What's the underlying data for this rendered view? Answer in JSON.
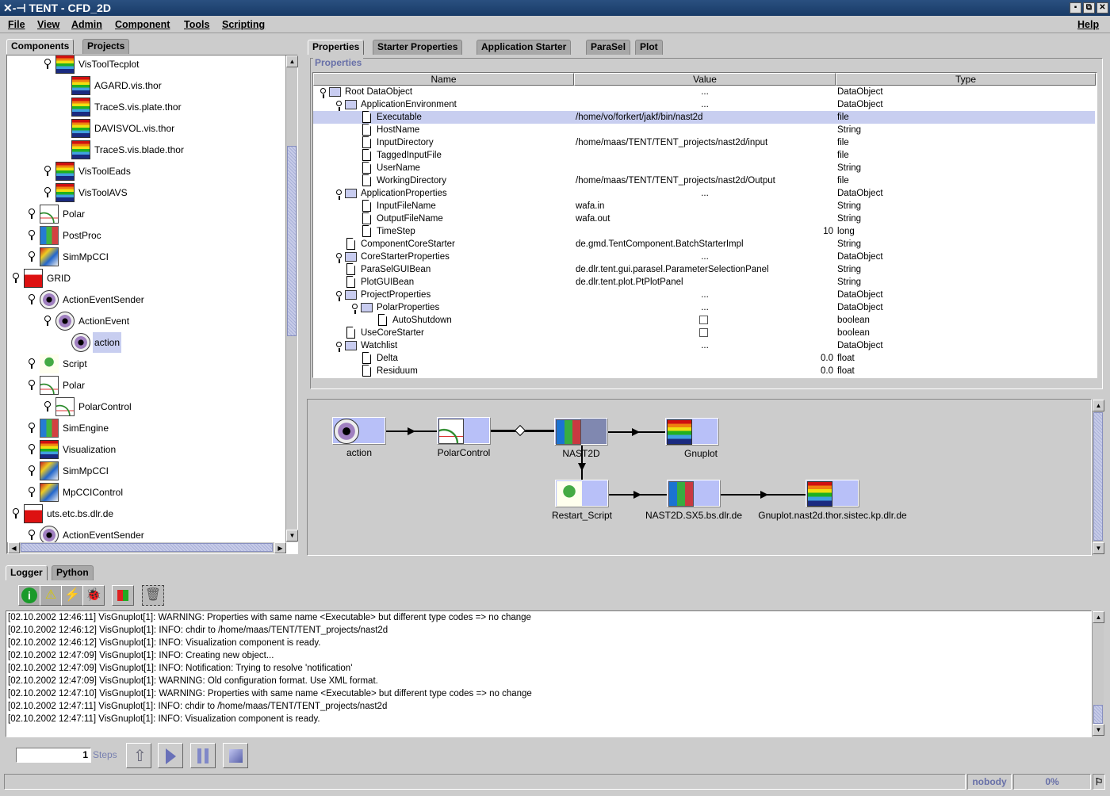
{
  "window": {
    "title": "TENT - CFD_2D"
  },
  "menu": [
    "File",
    "View",
    "Admin",
    "Component",
    "Tools",
    "Scripting"
  ],
  "help": "Help",
  "left_tabs": [
    "Components",
    "Projects"
  ],
  "tree": [
    {
      "label": "VisToolTecplot",
      "level": 3,
      "toggle": true,
      "icon": "rainbow"
    },
    {
      "label": "AGARD.vis.thor",
      "level": 4,
      "toggle": false,
      "icon": "rainbow"
    },
    {
      "label": "TraceS.vis.plate.thor",
      "level": 4,
      "toggle": false,
      "icon": "rainbow"
    },
    {
      "label": "DAVISVOL.vis.thor",
      "level": 4,
      "toggle": false,
      "icon": "rainbow"
    },
    {
      "label": "TraceS.vis.blade.thor",
      "level": 4,
      "toggle": false,
      "icon": "rainbow"
    },
    {
      "label": "VisToolEads",
      "level": 3,
      "toggle": true,
      "icon": "rainbow"
    },
    {
      "label": "VisToolAVS",
      "level": 3,
      "toggle": true,
      "icon": "rainbow"
    },
    {
      "label": "Polar",
      "level": 2,
      "toggle": true,
      "icon": "polar"
    },
    {
      "label": "PostProc",
      "level": 2,
      "toggle": true,
      "icon": "grid"
    },
    {
      "label": "SimMpCCI",
      "level": 2,
      "toggle": true,
      "icon": "simm"
    },
    {
      "label": "GRID",
      "level": 1,
      "toggle": true,
      "icon": "factory"
    },
    {
      "label": "ActionEventSender",
      "level": 2,
      "toggle": true,
      "icon": "compass"
    },
    {
      "label": "ActionEvent",
      "level": 3,
      "toggle": true,
      "icon": "compass"
    },
    {
      "label": "action",
      "level": 4,
      "toggle": false,
      "icon": "compass",
      "selected": true
    },
    {
      "label": "Script",
      "level": 2,
      "toggle": true,
      "icon": "snake"
    },
    {
      "label": "Polar",
      "level": 2,
      "toggle": true,
      "icon": "polar"
    },
    {
      "label": "PolarControl",
      "level": 3,
      "toggle": true,
      "icon": "polar"
    },
    {
      "label": "SimEngine",
      "level": 2,
      "toggle": true,
      "icon": "grid"
    },
    {
      "label": "Visualization",
      "level": 2,
      "toggle": true,
      "icon": "rainbow"
    },
    {
      "label": "SimMpCCI",
      "level": 2,
      "toggle": true,
      "icon": "simm"
    },
    {
      "label": "MpCCIControl",
      "level": 2,
      "toggle": true,
      "icon": "simm"
    },
    {
      "label": "uts.etc.bs.dlr.de",
      "level": 1,
      "toggle": true,
      "icon": "factory"
    },
    {
      "label": "ActionEventSender",
      "level": 2,
      "toggle": true,
      "icon": "compass"
    }
  ],
  "right_tabs": [
    "Properties",
    "Starter Properties",
    "Application Starter",
    "ParaSel",
    "Plot"
  ],
  "properties": {
    "group_label": "Properties",
    "columns": [
      "Name",
      "Value",
      "Type"
    ],
    "rows": [
      {
        "name": "Root DataObject",
        "value": "...",
        "type": "DataObject",
        "level": 0,
        "folder": true,
        "align": "center"
      },
      {
        "name": "ApplicationEnvironment",
        "value": "...",
        "type": "DataObject",
        "level": 1,
        "folder": true,
        "align": "center"
      },
      {
        "name": "Executable",
        "value": "/home/vo/forkert/jakf/bin/nast2d",
        "type": "file",
        "level": 2,
        "selected": true
      },
      {
        "name": "HostName",
        "value": "",
        "type": "String",
        "level": 2
      },
      {
        "name": "InputDirectory",
        "value": "/home/maas/TENT/TENT_projects/nast2d/input",
        "type": "file",
        "level": 2
      },
      {
        "name": "TaggedInputFile",
        "value": "",
        "type": "file",
        "level": 2
      },
      {
        "name": "UserName",
        "value": "",
        "type": "String",
        "level": 2
      },
      {
        "name": "WorkingDirectory",
        "value": "/home/maas/TENT/TENT_projects/nast2d/Output",
        "type": "file",
        "level": 2
      },
      {
        "name": "ApplicationProperties",
        "value": "...",
        "type": "DataObject",
        "level": 1,
        "folder": true,
        "align": "center"
      },
      {
        "name": "InputFileName",
        "value": "wafa.in",
        "type": "String",
        "level": 2
      },
      {
        "name": "OutputFileName",
        "value": "wafa.out",
        "type": "String",
        "level": 2
      },
      {
        "name": "TimeStep",
        "value": "10",
        "type": "long",
        "level": 2,
        "align": "right"
      },
      {
        "name": "ComponentCoreStarter",
        "value": "de.gmd.TentComponent.BatchStarterImpl",
        "type": "String",
        "level": 1
      },
      {
        "name": "CoreStarterProperties",
        "value": "...",
        "type": "DataObject",
        "level": 1,
        "folder": true,
        "align": "center"
      },
      {
        "name": "ParaSelGUIBean",
        "value": "de.dlr.tent.gui.parasel.ParameterSelectionPanel",
        "type": "String",
        "level": 1
      },
      {
        "name": "PlotGUIBean",
        "value": "de.dlr.tent.plot.PtPlotPanel",
        "type": "String",
        "level": 1
      },
      {
        "name": "ProjectProperties",
        "value": "...",
        "type": "DataObject",
        "level": 1,
        "folder": true,
        "align": "center"
      },
      {
        "name": "PolarProperties",
        "value": "...",
        "type": "DataObject",
        "level": 2,
        "folder": true,
        "align": "center"
      },
      {
        "name": "AutoShutdown",
        "value": "",
        "type": "boolean",
        "level": 3,
        "checkbox": true,
        "checked": false
      },
      {
        "name": "UseCoreStarter",
        "value": "",
        "type": "boolean",
        "level": 1,
        "checkbox": true,
        "checked": false
      },
      {
        "name": "Watchlist",
        "value": "...",
        "type": "DataObject",
        "level": 1,
        "folder": true,
        "align": "center"
      },
      {
        "name": "Delta",
        "value": "0.0",
        "type": "float",
        "level": 2,
        "align": "right"
      },
      {
        "name": "Residuum",
        "value": "0.0",
        "type": "float",
        "level": 2,
        "align": "right"
      }
    ]
  },
  "graph": {
    "nodes": [
      {
        "id": "action",
        "label": "action",
        "icon": "compass"
      },
      {
        "id": "polar",
        "label": "PolarControl",
        "icon": "polar"
      },
      {
        "id": "nast",
        "label": "NAST2D",
        "icon": "grid"
      },
      {
        "id": "gnu",
        "label": "Gnuplot",
        "icon": "rainbow"
      },
      {
        "id": "restart",
        "label": "Restart_Script",
        "icon": "snake"
      },
      {
        "id": "sx5",
        "label": "NAST2D.SX5.bs.dlr.de",
        "icon": "grid"
      },
      {
        "id": "gnu2",
        "label": "Gnuplot.nast2d.thor.sistec.kp.dlr.de",
        "icon": "rainbow"
      }
    ]
  },
  "logger": {
    "tabs": [
      "Logger",
      "Python"
    ],
    "lines": [
      "[02.10.2002 12:46:11] VisGnuplot[1]: WARNING: Properties with same name <Executable> but different type codes => no change",
      "[02.10.2002 12:46:12] VisGnuplot[1]: INFO: chdir to /home/maas/TENT/TENT_projects/nast2d",
      "[02.10.2002 12:46:12] VisGnuplot[1]: INFO: Visualization component is ready.",
      "[02.10.2002 12:47:09] VisGnuplot[1]: INFO: Creating new object...",
      "[02.10.2002 12:47:09] VisGnuplot[1]: INFO: Notification: Trying to resolve 'notification'",
      "[02.10.2002 12:47:09] VisGnuplot[1]: WARNING: Old configuration format. Use XML format.",
      "[02.10.2002 12:47:10] VisGnuplot[1]: WARNING: Properties with same name <Executable> but different type codes => no change",
      "[02.10.2002 12:47:11] VisGnuplot[1]: INFO: chdir to /home/maas/TENT/TENT_projects/nast2d",
      "[02.10.2002 12:47:11] VisGnuplot[1]: INFO: Visualization component is ready."
    ]
  },
  "steps": {
    "value": "1",
    "label": "Steps"
  },
  "status": {
    "user": "nobody",
    "progress": "0%"
  }
}
